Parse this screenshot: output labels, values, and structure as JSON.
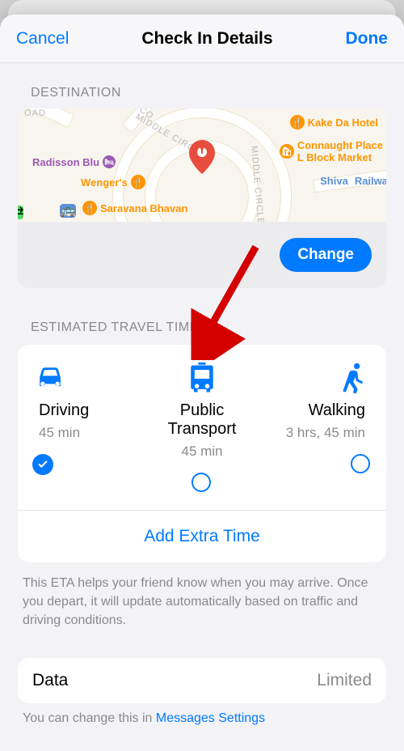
{
  "nav": {
    "cancel": "Cancel",
    "title": "Check In Details",
    "done": "Done"
  },
  "destination": {
    "header": "DESTINATION",
    "change": "Change",
    "map": {
      "pois": {
        "kake": "Kake Da Hotel",
        "connaught_line1": "Connaught Place",
        "connaught_line2": "L Block Market",
        "shiva_line1": "Shiva",
        "shiva_line2": "Railwa",
        "radisson": "Radisson Blu",
        "wengers": "Wenger's",
        "saravana": "Saravana Bhavan",
        "middle_circle": "MIDDLE CIRCLE",
        "road_labels": {
          "oad": "OAD",
          "co": "CO"
        }
      }
    }
  },
  "travel": {
    "header": "ESTIMATED TRAVEL TIME",
    "modes": [
      {
        "id": "driving",
        "label": "Driving",
        "time": "45 min",
        "selected": true
      },
      {
        "id": "public",
        "label": "Public Transport",
        "time": "45 min",
        "selected": false
      },
      {
        "id": "walking",
        "label": "Walking",
        "time": "3 hrs, 45 min",
        "selected": false
      }
    ],
    "add_extra": "Add Extra Time",
    "desc": "This ETA helps your friend know when you may arrive. Once you depart, it will update automatically based on traffic and driving conditions."
  },
  "data_row": {
    "label": "Data",
    "value": "Limited",
    "desc_prefix": "You can change this in ",
    "desc_link": "Messages Settings"
  }
}
